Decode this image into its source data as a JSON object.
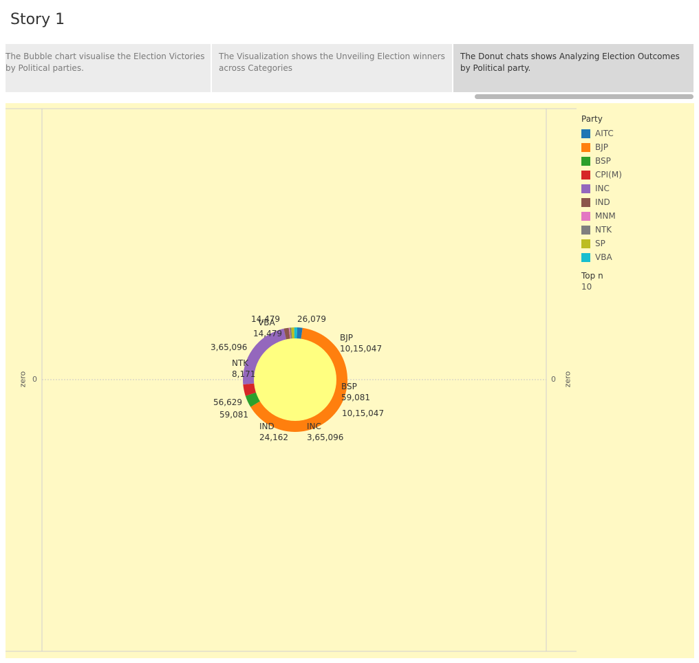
{
  "story": {
    "title": "Story 1"
  },
  "navigator": {
    "points": [
      "The Bubble chart visualise the Election Victories by Political parties.",
      "The Visualization shows the Unveiling Election winners across Categories",
      "The Donut chats shows Analyzing Election Outcomes by Political party."
    ],
    "active_index": 2
  },
  "axes": {
    "left_title": "zero",
    "right_title": "zero",
    "left_tick": "0",
    "right_tick": "0"
  },
  "legend": {
    "title": "Party",
    "items": [
      {
        "label": "AITC",
        "color": "#1f77b4"
      },
      {
        "label": "BJP",
        "color": "#ff7f0e"
      },
      {
        "label": "BSP",
        "color": "#2ca02c"
      },
      {
        "label": "CPI(M)",
        "color": "#d62728"
      },
      {
        "label": "INC",
        "color": "#9467bd"
      },
      {
        "label": "IND",
        "color": "#8c564b"
      },
      {
        "label": "MNM",
        "color": "#e377c2"
      },
      {
        "label": "NTK",
        "color": "#7f7f7f"
      },
      {
        "label": "SP",
        "color": "#bcbd22"
      },
      {
        "label": "VBA",
        "color": "#17becf"
      }
    ]
  },
  "filter": {
    "title": "Top n",
    "value": "10"
  },
  "chart_data": {
    "type": "pie",
    "variant": "donut",
    "center_color": "#ffff80",
    "background_color": "#fff9c4",
    "slices": [
      {
        "party": "AITC",
        "value": 26079,
        "color": "#1f77b4"
      },
      {
        "party": "BJP",
        "value": 1015047,
        "color": "#ff7f0e"
      },
      {
        "party": "BSP",
        "value": 59081,
        "color": "#2ca02c"
      },
      {
        "party": "CPI(M)",
        "value": 56629,
        "color": "#d62728"
      },
      {
        "party": "INC",
        "value": 365096,
        "color": "#9467bd"
      },
      {
        "party": "IND",
        "value": 24162,
        "color": "#8c564b"
      },
      {
        "party": "MNM",
        "value": 4000,
        "color": "#e377c2"
      },
      {
        "party": "NTK",
        "value": 8171,
        "color": "#7f7f7f"
      },
      {
        "party": "SP",
        "value": 14479,
        "color": "#bcbd22"
      },
      {
        "party": "VBA",
        "value": 14479,
        "color": "#17becf"
      }
    ],
    "labels": [
      {
        "lines": [
          "14,479"
        ]
      },
      {
        "lines": [
          "26,079"
        ]
      },
      {
        "lines": [
          "VBA"
        ]
      },
      {
        "lines": [
          "14,479"
        ]
      },
      {
        "lines": [
          "BJP",
          "10,15,047"
        ]
      },
      {
        "lines": [
          "3,65,096"
        ]
      },
      {
        "lines": [
          "NTK",
          "8,171"
        ]
      },
      {
        "lines": [
          "BSP",
          "59,081"
        ]
      },
      {
        "lines": [
          "10,15,047"
        ]
      },
      {
        "lines": [
          "56,629"
        ]
      },
      {
        "lines": [
          "59,081"
        ]
      },
      {
        "lines": [
          "IND",
          "24,162"
        ]
      },
      {
        "lines": [
          "INC",
          "3,65,096"
        ]
      }
    ]
  }
}
